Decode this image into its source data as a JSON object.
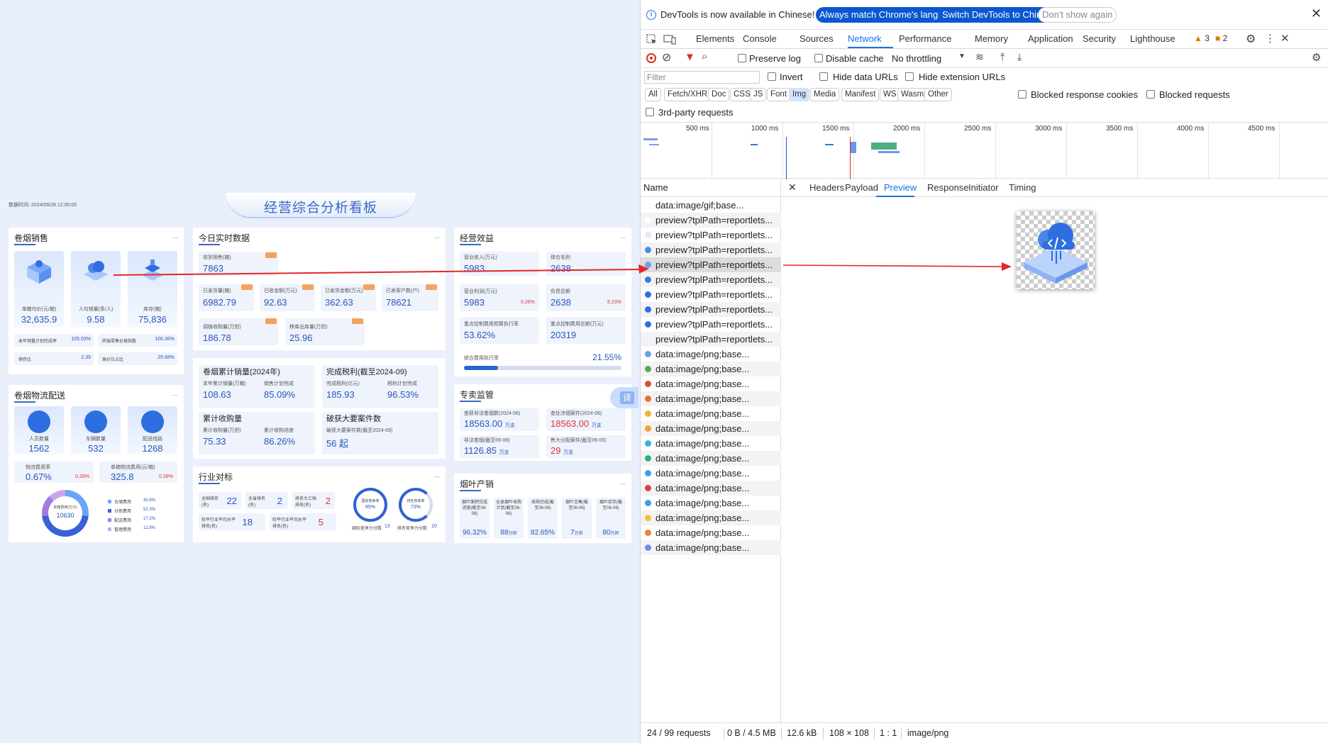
{
  "dashboard": {
    "date_label": "数据时间:",
    "date_value": "2024/06/28 12:00:00",
    "title": "经营综合分析看板",
    "panel1": {
      "title": "卷烟销售",
      "items": [
        {
          "label": "单箱均价(元/箱)",
          "value": "32,635.9"
        },
        {
          "label": "人均销量(条/人)",
          "value": "9.58"
        },
        {
          "label": "库存(箱)",
          "value": "75,836"
        }
      ],
      "stats": [
        {
          "label": "本年销量计划完成率",
          "value": "105.03%"
        },
        {
          "label": "终端零售价格指数",
          "value": "100.36%"
        },
        {
          "label": "销存比",
          "value": "2.35"
        },
        {
          "label": "高价位占比",
          "value": "25.68%"
        }
      ]
    },
    "panel2": {
      "title": "今日实时数据",
      "c1": {
        "label": "收到销售(箱)",
        "value": "7863"
      },
      "row2": [
        {
          "label": "已发货量(箱)",
          "value": "6982.79"
        },
        {
          "label": "已收金额(万元)",
          "value": "92.63"
        },
        {
          "label": "已发货金额(万元)",
          "value": "362.63"
        },
        {
          "label": "已发客户数(户)",
          "value": "78621"
        }
      ],
      "row3": [
        {
          "label": "调拨收购量(万担)",
          "value": "186.78"
        },
        {
          "label": "移库出库量(万担)",
          "value": "25.96"
        }
      ]
    },
    "panel3": {
      "title": "经营效益",
      "items": [
        {
          "label": "营业收入(万元)",
          "value": "5983"
        },
        {
          "label": "综合毛利",
          "value": "2638"
        },
        {
          "label": "营业利润(万元)",
          "value": "5983",
          "delta": "0.26%"
        },
        {
          "label": "负债总额",
          "value": "2638",
          "delta": "5.23%"
        },
        {
          "label": "重点控制费用预算执行率",
          "value": "53.62%"
        },
        {
          "label": "重点控制费用总额(万元)",
          "value": "20319"
        }
      ],
      "progress_label": "综合费用执行率",
      "progress_value": "21.55%",
      "progress": 0.2155
    },
    "panel4": {
      "boxes": [
        {
          "title": "卷烟累计销量(2024年)",
          "l1": "本年累计销量(万箱)",
          "v1": "108.63",
          "l2": "销售计划完成",
          "v2": "85.09%"
        },
        {
          "title": "完成税利(截至2024-09)",
          "l1": "完成税利(亿元)",
          "v1": "185.93",
          "l2": "税利计划完成",
          "v2": "96.53%"
        },
        {
          "title": "累计收购量",
          "l1": "累计收购量(万担)",
          "v1": "75.33",
          "l2": "累计收购进度",
          "v2": "86.26%"
        },
        {
          "title": "破获大要案件数",
          "l1": "破获大要案件数(截至2024-09)",
          "v1": "56 起",
          "l2": "",
          "v2": ""
        }
      ]
    },
    "panel5": {
      "title": "卷烟物流配送",
      "items": [
        {
          "label": "人员数量",
          "value": "1562"
        },
        {
          "label": "车辆数量",
          "value": "532"
        },
        {
          "label": "配送线路",
          "value": "1268"
        }
      ],
      "s1": {
        "label": "物流费用率",
        "value": "0.67%",
        "delta": "0.28%"
      },
      "s2": {
        "label": "单箱物流费用(元/箱)",
        "value": "325.8",
        "delta": "0.28%"
      },
      "donut": {
        "center_label": "单箱费用(万元)",
        "center_value": "10630",
        "legend": [
          {
            "name": "仓储费用",
            "value": "30.6%",
            "color": "#6aa6f5"
          },
          {
            "name": "分拣费用",
            "value": "52.3%",
            "color": "#3a62d8"
          },
          {
            "name": "配送费用",
            "value": "17.2%",
            "color": "#a37ae0"
          },
          {
            "name": "管理费用",
            "value": "12.9%",
            "color": "#c8a6ee"
          }
        ]
      }
    },
    "panel6": {
      "title": "行业对标",
      "cells": [
        {
          "label": "全国排名(名)",
          "value": "22"
        },
        {
          "label": "全省排名(名)",
          "value": "2"
        },
        {
          "label": "排名大三档排名(名)",
          "value": "2"
        },
        {
          "label": "较平行业平均水平排名(名)",
          "value": "18"
        },
        {
          "label": "较平行业平均水平排名(名)",
          "value": "5"
        }
      ],
      "rings": [
        {
          "label": "国际竞争率",
          "value": "85%",
          "foot": "国际竞争力分数",
          "foot_val": "13"
        },
        {
          "label": "排名竞争率",
          "value": "73%",
          "foot": "排名竞争力分数",
          "foot_val": "10"
        }
      ]
    },
    "panel7": {
      "title": "专卖监管",
      "items": [
        {
          "label": "查获非法卷烟数(2024-06)",
          "value": "18563.00",
          "unit": "万支",
          "red": false
        },
        {
          "label": "查处涉烟案件(2024-06)",
          "value": "18563.00",
          "unit": "万支",
          "red": true
        },
        {
          "label": "非法卷烟(截至06-06)",
          "value": "1126.85",
          "unit": "万支",
          "red": false
        },
        {
          "label": "售大分配案件(截至06-05)",
          "value": "29",
          "unit": "万支",
          "red": true
        }
      ]
    },
    "panel8": {
      "title": "烟叶产销",
      "items": [
        {
          "label": "烟叶面积完成进度(截至06-06)",
          "value": "96.32%"
        },
        {
          "label": "全县烟叶收购计划(截至06-06)",
          "value": "88",
          "unit": "万担"
        },
        {
          "label": "收购完成(截至06-06)",
          "value": "82.65%"
        },
        {
          "label": "烟叶交售(截至06-06)",
          "value": "7",
          "unit": "万担"
        },
        {
          "label": "烟叶库存(截至06-06)",
          "value": "80",
          "unit": "万担"
        }
      ]
    },
    "translate_label": "译"
  },
  "devtools": {
    "banner": {
      "text": "DevTools is now available in Chinese!",
      "btn1": "Always match Chrome's language",
      "btn2": "Switch DevTools to Chinese",
      "btn3": "Don't show again"
    },
    "tabs": [
      "Elements",
      "Console",
      "Sources",
      "Network",
      "Performance",
      "Memory",
      "Application",
      "Security",
      "Lighthouse"
    ],
    "warn_count": "3",
    "issue_count": "2",
    "toolbar": {
      "preserve": "Preserve log",
      "disable_cache": "Disable cache",
      "throttle": "No throttling"
    },
    "filter": {
      "placeholder": "Filter",
      "invert": "Invert",
      "hide_data": "Hide data URLs",
      "hide_ext": "Hide extension URLs"
    },
    "types": [
      "All",
      "Fetch/XHR",
      "Doc",
      "CSS",
      "JS",
      "Font",
      "Img",
      "Media",
      "Manifest",
      "WS",
      "Wasm",
      "Other"
    ],
    "blocked_cookies": "Blocked response cookies",
    "blocked_requests": "Blocked requests",
    "third_party": "3rd-party requests",
    "timeline_ticks": [
      "500 ms",
      "1000 ms",
      "1500 ms",
      "2000 ms",
      "2500 ms",
      "3000 ms",
      "3500 ms",
      "4000 ms",
      "4500 ms"
    ],
    "name_header": "Name",
    "detail_tabs": [
      "Headers",
      "Payload",
      "Preview",
      "Response",
      "Initiator",
      "Timing"
    ],
    "requests": [
      {
        "name": "data:image/gif;base...",
        "color": "#ffffff"
      },
      {
        "name": "preview?tplPath=reportlets...",
        "color": "#ffffff"
      },
      {
        "name": "preview?tplPath=reportlets...",
        "color": "#dfe8f8"
      },
      {
        "name": "preview?tplPath=reportlets...",
        "color": "#4a8df0"
      },
      {
        "name": "preview?tplPath=reportlets...",
        "color": "#6aa0f2"
      },
      {
        "name": "preview?tplPath=reportlets...",
        "color": "#3b78e7"
      },
      {
        "name": "preview?tplPath=reportlets...",
        "color": "#2d6ee0"
      },
      {
        "name": "preview?tplPath=reportlets...",
        "color": "#2d6ee0"
      },
      {
        "name": "preview?tplPath=reportlets...",
        "color": "#2d6ee0"
      },
      {
        "name": "preview?tplPath=reportlets...",
        "color": "#eef2fa"
      },
      {
        "name": "data:image/png;base...",
        "color": "#6aa0f2"
      },
      {
        "name": "data:image/png;base...",
        "color": "#4caf50"
      },
      {
        "name": "data:image/png;base...",
        "color": "#e04a3b"
      },
      {
        "name": "data:image/png;base...",
        "color": "#e8712b"
      },
      {
        "name": "data:image/png;base...",
        "color": "#e8b82b"
      },
      {
        "name": "data:image/png;base...",
        "color": "#f0a030"
      },
      {
        "name": "data:image/png;base...",
        "color": "#3bb0e0"
      },
      {
        "name": "data:image/png;base...",
        "color": "#2bb08a"
      },
      {
        "name": "data:image/png;base...",
        "color": "#3b9fe0"
      },
      {
        "name": "data:image/png;base...",
        "color": "#e03b4a"
      },
      {
        "name": "data:image/png;base...",
        "color": "#3b9fe0"
      },
      {
        "name": "data:image/png;base...",
        "color": "#f0c040"
      },
      {
        "name": "data:image/png;base...",
        "color": "#f08040"
      },
      {
        "name": "data:image/png;base...",
        "color": "#6a8ff0"
      }
    ],
    "status": {
      "requests": "24 / 99 requests",
      "transferred": "0 B / 4.5 MB",
      "size": "12.6 kB",
      "dims": "108 × 108",
      "ratio": "1 : 1",
      "mime": "image/png"
    }
  }
}
